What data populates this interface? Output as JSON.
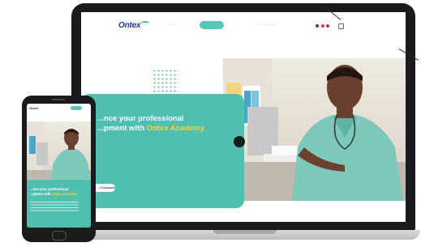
{
  "site": {
    "logo": "Ontex",
    "nav": {
      "link_1": "·········",
      "cta_pill": "",
      "link_2": "···  ········  ··········"
    },
    "hero": {
      "title_line1": "...nce your professional",
      "title_line2_prefix": "...pment with ",
      "title_highlight": "Ontex Academy",
      "body": "",
      "cta": "...t Courses"
    }
  },
  "colors": {
    "brand_teal": "#4fbfb0",
    "brand_navy": "#1e3a8a",
    "highlight_yellow": "#f6d33c",
    "device_frame": "#1b1b1d"
  },
  "icons": {
    "flag_red": "flag-icon",
    "share": "share-icon"
  }
}
